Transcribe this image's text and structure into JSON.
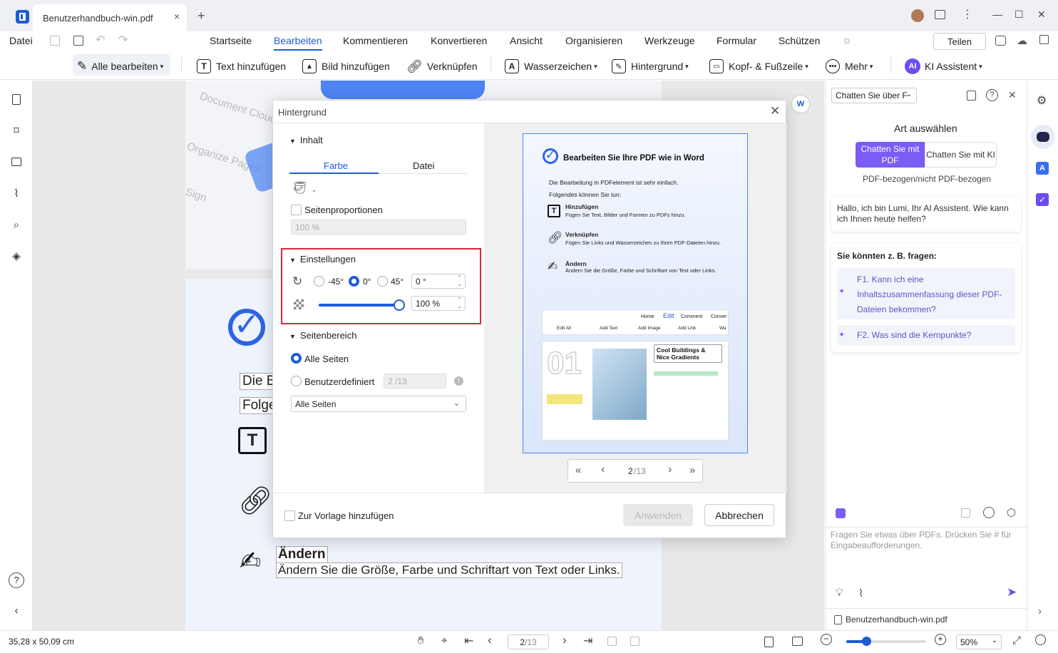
{
  "titlebar": {
    "tab_title": "Benutzerhandbuch-win.pdf",
    "tab_close": "×",
    "new_tab": "+",
    "minimize": "—",
    "maximize": "☐",
    "close": "✕"
  },
  "menubar": {
    "file": "Datei",
    "items": [
      "Startseite",
      "Bearbeiten",
      "Kommentieren",
      "Konvertieren",
      "Ansicht",
      "Organisieren",
      "Werkzeuge",
      "Formular",
      "Schützen"
    ],
    "share": "Teilen"
  },
  "toolbar": {
    "edit_all": "Alle bearbeiten",
    "add_text": "Text hinzufügen",
    "add_image": "Bild hinzufügen",
    "link": "Verknüpfen",
    "watermark": "Wasserzeichen",
    "background": "Hintergrund",
    "header_footer": "Kopf- & Fußzeile",
    "more": "Mehr",
    "ai": "KI Assistent",
    "ai_badge": "AI"
  },
  "document": {
    "bg_labels": [
      "Document Cloud",
      "Organize Pages",
      "Sign"
    ],
    "line1": "Die B",
    "line2": "Folge",
    "change_title": "Ändern",
    "change_desc": "Ändern Sie die Größe, Farbe und Schriftart von Text oder Links."
  },
  "dialog": {
    "title": "Hintergrund",
    "content_header": "Inhalt",
    "tab_color": "Farbe",
    "tab_file": "Datei",
    "page_ratio": "Seitenproportionen",
    "ratio_value": "100 %",
    "settings_header": "Einstellungen",
    "rot_neg45": "-45°",
    "rot_0": "0°",
    "rot_45": "45°",
    "rotation_value": "0 °",
    "opacity_value": "100 %",
    "opacity": 1.0,
    "range_header": "Seitenbereich",
    "all_pages": "Alle Seiten",
    "custom": "Benutzerdefiniert",
    "custom_value": "2 /13",
    "pages_select": "Alle Seiten",
    "add_template": "Zur Vorlage hinzufügen",
    "apply": "Anwenden",
    "cancel": "Abbrechen"
  },
  "preview": {
    "heading": "Bearbeiten Sie Ihre PDF wie in Word",
    "intro1": "Die Bearbeitung in PDFelement ist sehr einfach.",
    "intro2": "Folgendes können Sie tun:",
    "f1_title": "Hinzufügen",
    "f1_desc": "Fügen Sie Text, Bilder und Formen zu PDFs hinzu.",
    "f2_title": "Verknüpfen",
    "f2_desc": "Fügen Sie Links und Wasserzeichen zu Ihren PDF-Dateien hinzu.",
    "f3_title": "Ändern",
    "f3_desc": "Ändern Sie die Größe, Farbe und Schriftart von Text oder Links.",
    "mini_tabs": [
      "Home",
      "Edit",
      "Comment",
      "Conver"
    ],
    "mini_tools": [
      "Edit All",
      "Add Text",
      "Add Image",
      "Add Link",
      "Wa"
    ],
    "mini_number": "01",
    "mini_title": "Cool Buildings & Nice Gradients",
    "page_current": "2",
    "page_total": "/13",
    "nav_first": "«",
    "nav_prev": "‹",
    "nav_next": "›",
    "nav_last": "»"
  },
  "rightpanel": {
    "dropdown": "Chatten Sie über F",
    "choose": "Art auswählen",
    "btn_pdf": "Chatten Sie mit PDF",
    "btn_ai": "Chatten Sie mit KI",
    "subtitle": "PDF-bezogen/nicht PDF-bezogen",
    "greeting": "Hallo, ich bin Lumi, Ihr AI Assistent. Wie kann ich Ihnen heute helfen?",
    "ask_header": "Sie könnten z. B. fragen:",
    "q1": "F1. Kann ich eine Inhaltszusammenfassung dieser PDF-Dateien bekommen?",
    "q2": "F2. Was sind die Kernpunkte?",
    "input_placeholder": "Fragen Sie etwas über PDFs. Drücken Sie # für Eingabeaufforderungen.",
    "file": "Benutzerhandbuch-win.pdf"
  },
  "statusbar": {
    "dimensions": "35,28 x 50,09 cm",
    "page_current": "2",
    "page_total": "/13",
    "zoom": "50%",
    "zoom_level": 0.5
  },
  "colors": {
    "accent": "#1e5bd7",
    "highlight": "#d9263a",
    "purple": "#6d4cf0"
  }
}
